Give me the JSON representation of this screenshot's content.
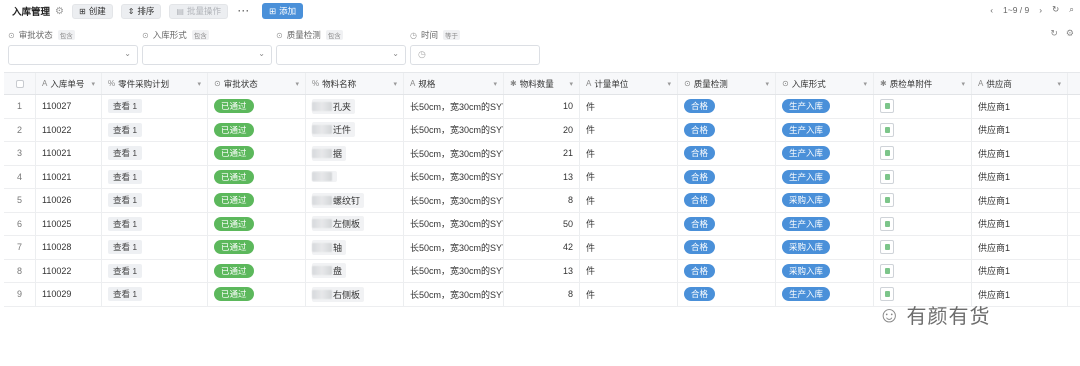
{
  "toolbar": {
    "title": "入库管理",
    "create_label": "创建",
    "sort_label": "排序",
    "batch_label": "批量操作",
    "more_label": "···",
    "add_label": "添加",
    "pagination": "1~9 / 9"
  },
  "filters": [
    {
      "label": "审批状态",
      "op": "包含"
    },
    {
      "label": "入库形式",
      "op": "包含"
    },
    {
      "label": "质量检测",
      "op": "包含"
    },
    {
      "label": "时间",
      "op": "等于"
    }
  ],
  "table": {
    "columns": [
      "入库单号",
      "零件采购计划",
      "审批状态",
      "物料名称",
      "规格",
      "物料数量",
      "计量单位",
      "质量检测",
      "入库形式",
      "质检单附件",
      "供应商"
    ],
    "rows": [
      {
        "no": "1",
        "order": "110027",
        "plan": "查看 1",
        "status": "已通过",
        "material": "孔夹",
        "spec": "长50cm，宽30cm的SYT",
        "qty": "10",
        "unit": "件",
        "quality": "合格",
        "form": "生产入库",
        "supplier": "供应商1"
      },
      {
        "no": "2",
        "order": "110022",
        "plan": "查看 1",
        "status": "已通过",
        "material": "迁件",
        "spec": "长50cm，宽30cm的SYT",
        "qty": "20",
        "unit": "件",
        "quality": "合格",
        "form": "生产入库",
        "supplier": "供应商1"
      },
      {
        "no": "3",
        "order": "110021",
        "plan": "查看 1",
        "status": "已通过",
        "material": "据",
        "spec": "长50cm，宽30cm的SYT",
        "qty": "21",
        "unit": "件",
        "quality": "合格",
        "form": "生产入库",
        "supplier": "供应商1"
      },
      {
        "no": "4",
        "order": "110021",
        "plan": "查看 1",
        "status": "已通过",
        "material": "",
        "spec": "长50cm，宽30cm的SYT",
        "qty": "13",
        "unit": "件",
        "quality": "合格",
        "form": "生产入库",
        "supplier": "供应商1"
      },
      {
        "no": "5",
        "order": "110026",
        "plan": "查看 1",
        "status": "已通过",
        "material": "螺纹钉",
        "spec": "长50cm，宽30cm的SYT",
        "qty": "8",
        "unit": "件",
        "quality": "合格",
        "form": "采购入库",
        "supplier": "供应商1"
      },
      {
        "no": "6",
        "order": "110025",
        "plan": "查看 1",
        "status": "已通过",
        "material": "左侧板",
        "spec": "长50cm，宽30cm的SYT",
        "qty": "50",
        "unit": "件",
        "quality": "合格",
        "form": "生产入库",
        "supplier": "供应商1"
      },
      {
        "no": "7",
        "order": "110028",
        "plan": "查看 1",
        "status": "已通过",
        "material": "轴",
        "spec": "长50cm，宽30cm的SYT",
        "qty": "42",
        "unit": "件",
        "quality": "合格",
        "form": "采购入库",
        "supplier": "供应商1"
      },
      {
        "no": "8",
        "order": "110022",
        "plan": "查看 1",
        "status": "已通过",
        "material": "盘",
        "spec": "长50cm，宽30cm的SYT",
        "qty": "13",
        "unit": "件",
        "quality": "合格",
        "form": "采购入库",
        "supplier": "供应商1"
      },
      {
        "no": "9",
        "order": "110029",
        "plan": "查看 1",
        "status": "已通过",
        "material": "右侧板",
        "spec": "长50cm，宽30cm的SYT",
        "qty": "8",
        "unit": "件",
        "quality": "合格",
        "form": "生产入库",
        "supplier": "供应商1"
      }
    ]
  },
  "watermark": {
    "text": "有颜有货"
  },
  "colors": {
    "green": "#5cb85c",
    "blue": "#4a90d9"
  }
}
